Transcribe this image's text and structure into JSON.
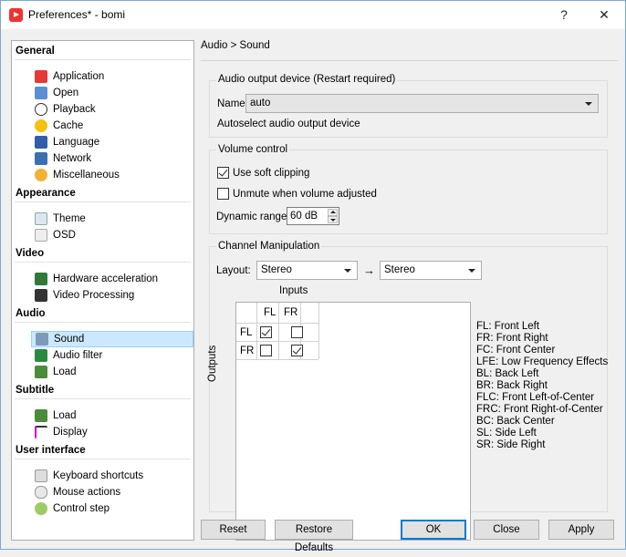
{
  "window": {
    "title": "Preferences* - bomi",
    "help": "?",
    "close": "✕"
  },
  "nav": {
    "groups": [
      {
        "label": "General",
        "items": [
          "Application",
          "Open",
          "Playback",
          "Cache",
          "Language",
          "Network",
          "Miscellaneous"
        ]
      },
      {
        "label": "Appearance",
        "items": [
          "Theme",
          "OSD"
        ]
      },
      {
        "label": "Video",
        "items": [
          "Hardware acceleration",
          "Video Processing"
        ]
      },
      {
        "label": "Audio",
        "items": [
          "Sound",
          "Audio filter",
          "Load"
        ]
      },
      {
        "label": "Subtitle",
        "items": [
          "Load",
          "Display"
        ]
      },
      {
        "label": "User interface",
        "items": [
          "Keyboard shortcuts",
          "Mouse actions",
          "Control step"
        ]
      }
    ],
    "selected": "Sound"
  },
  "main": {
    "breadcrumb": "Audio > Sound",
    "audio_output": {
      "title": "Audio output device (Restart required)",
      "name_label": "Name",
      "name_value": "auto",
      "description": "Autoselect audio output device"
    },
    "volume": {
      "title": "Volume control",
      "soft_clipping_label": "Use soft clipping",
      "soft_clipping_checked": true,
      "unmute_label": "Unmute when volume adjusted",
      "unmute_checked": false,
      "dynamic_range_label": "Dynamic range",
      "dynamic_range_value": "60 dB"
    },
    "channel": {
      "title": "Channel Manipulation",
      "layout_label": "Layout:",
      "layout_from": "Stereo",
      "arrow": "→",
      "layout_to": "Stereo",
      "inputs_label": "Inputs",
      "outputs_label": "Outputs",
      "cols": [
        "FL",
        "FR"
      ],
      "rows": [
        "FL",
        "FR"
      ],
      "matrix": [
        [
          true,
          false
        ],
        [
          false,
          true
        ]
      ],
      "legend": [
        "FL: Front Left",
        "FR: Front Right",
        "FC: Front Center",
        "LFE: Low Frequency Effects",
        "BL: Back Left",
        "BR: Back Right",
        "FLC: Front Left-of-Center",
        "FRC: Front Right-of-Center",
        "BC: Back Center",
        "SL: Side Left",
        "SR: Side Right"
      ]
    }
  },
  "buttons": {
    "reset": "Reset",
    "restore": "Restore Defaults",
    "ok": "OK",
    "close": "Close",
    "apply": "Apply"
  },
  "colors": {
    "selection": "#cce8ff",
    "accent": "#0078d7"
  },
  "icons": {
    "Application": "app-icon",
    "Open": "folder-icon",
    "Playback": "play-icon",
    "Cache": "cache-icon",
    "Language": "language-icon",
    "Network": "network-icon",
    "Miscellaneous": "misc-icon",
    "Theme": "theme-icon",
    "OSD": "osd-icon",
    "Hardware acceleration": "chip-icon",
    "Video Processing": "film-icon",
    "Sound": "speaker-icon",
    "Audio filter": "equalizer-icon",
    "Load": "load-icon",
    "Display": "text-display-icon",
    "Keyboard shortcuts": "keyboard-icon",
    "Mouse actions": "mouse-icon",
    "Control step": "control-step-icon"
  }
}
